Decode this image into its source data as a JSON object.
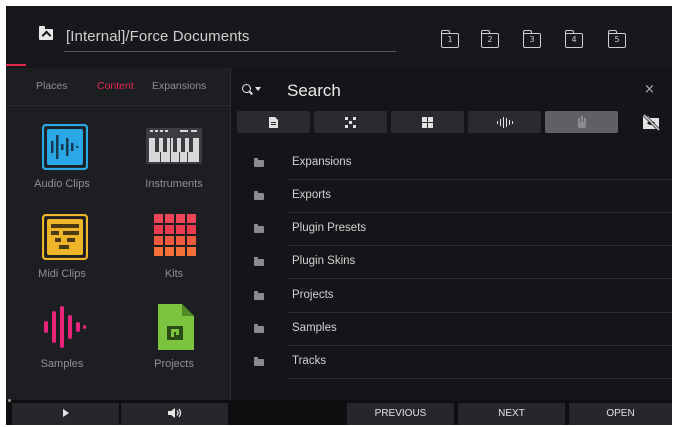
{
  "header": {
    "path": "[Internal]/Force Documents",
    "slots": [
      "1",
      "2",
      "3",
      "4",
      "5"
    ]
  },
  "left_panel": {
    "tabs": [
      "Places",
      "Content",
      "Expansions"
    ],
    "active_tab": "Content",
    "tiles": [
      "Audio Clips",
      "Instruments",
      "Midi Clips",
      "Kits",
      "Samples",
      "Projects"
    ]
  },
  "search": {
    "placeholder": "Search",
    "close_glyph": "×"
  },
  "filters": {
    "icons": [
      "document-icon",
      "grid-dots-icon",
      "four-squares-icon",
      "waveform-icon",
      "hand-icon",
      "hide-icon"
    ],
    "active_index": 4
  },
  "files": [
    "Expansions",
    "Exports",
    "Plugin Presets",
    "Plugin Skins",
    "Projects",
    "Samples",
    "Tracks"
  ],
  "bottom_bar": {
    "previous": "PREVIOUS",
    "next": "NEXT",
    "open": "OPEN"
  },
  "colors": {
    "accent": "#e0294d",
    "audio_clips": "#2aa8e6",
    "midi_clips": "#f0b428",
    "kits": "#ec3a4e",
    "samples": "#e6247a",
    "projects": "#7cc440"
  }
}
